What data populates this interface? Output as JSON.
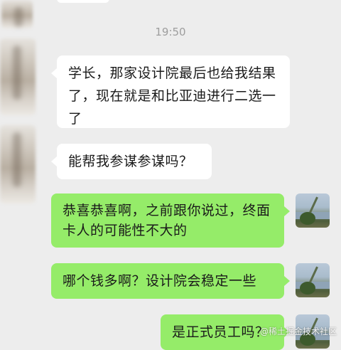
{
  "timestamp": "19:50",
  "messages": [
    {
      "side": "in",
      "text": "学长，那家设计院最后也给我结果了，现在就是和比亚迪进行二选一了"
    },
    {
      "side": "in",
      "text": "能帮我参谋参谋吗？"
    },
    {
      "side": "out",
      "text": "恭喜恭喜啊，之前跟你说过，终面卡人的可能性不大的"
    },
    {
      "side": "out",
      "text": "哪个钱多啊？设计院会稳定一些"
    },
    {
      "side": "out",
      "text": "是正式员工吗？"
    }
  ],
  "watermark": "@稀土掘金技术社区",
  "colors": {
    "background": "#ededed",
    "incoming_bubble": "#ffffff",
    "outgoing_bubble": "#95ec69"
  }
}
